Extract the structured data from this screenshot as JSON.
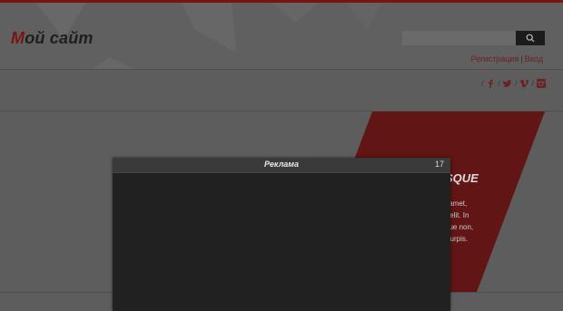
{
  "header": {
    "logo_first": "М",
    "logo_rest": "ой сайт",
    "search_placeholder": "",
    "auth_register": "Регистрация",
    "auth_separator": "|",
    "auth_login": "Вход"
  },
  "social": {
    "separator": "/",
    "icons": [
      "facebook-icon",
      "twitter-icon",
      "vimeo-icon",
      "instagram-icon"
    ]
  },
  "banner": {
    "heading": "SQUE",
    "lines": [
      "it amet,",
      "ng elit. In",
      "gue non,",
      "ur turpis."
    ]
  },
  "modal": {
    "title": "Реклама",
    "countdown": "17"
  },
  "colors": {
    "accent": "#7a1414",
    "overlay": "#5d5d5d",
    "modal_bg": "#212121"
  }
}
